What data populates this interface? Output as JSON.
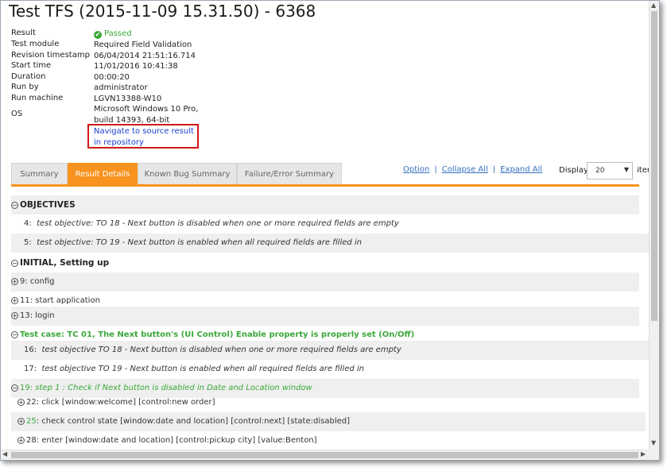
{
  "title": "Test TFS (2015-11-09 15.31.50) - 6368",
  "info": {
    "result_label": "Result",
    "result_value": "Passed",
    "module_label": "Test module",
    "module_value": "Required Field Validation",
    "revision_label": "Revision timestamp",
    "revision_value": "06/04/2014 21:51:16.714",
    "start_label": "Start time",
    "start_value": "11/01/2016 10:41:38",
    "duration_label": "Duration",
    "duration_value": "00:00:20",
    "runby_label": "Run by",
    "runby_value": "administrator",
    "machine_label": "Run machine",
    "machine_value": "LGVN13388-W10",
    "os_label": "OS",
    "os_value_1": "Microsoft Windows 10 Pro,",
    "os_value_2": "build 14393, 64-bit",
    "nav_link": "Navigate to source result in repository"
  },
  "tabs": [
    "Summary",
    "Result Details",
    "Known Bug Summary",
    "Failure/Error Summary"
  ],
  "active_tab": "Result Details",
  "links": {
    "option": "Option",
    "collapse": "Collapse All",
    "expand": "Expand All"
  },
  "display": {
    "label": "Display",
    "value": "20",
    "suffix": "iter"
  },
  "tree": {
    "objectives": "OBJECTIVES",
    "obj_4_num": "4:",
    "obj_4": "test objective: TO 18 - Next button is disabled when one or more required fields are empty",
    "obj_5_num": "5:",
    "obj_5": "test objective: TO 19 - Next button is enabled when all required fields are filled in",
    "initial": "INITIAL, Setting up",
    "r9": "9: config",
    "r11": "11: start application",
    "r13": "13: login",
    "tc": "Test case: TC 01, The Next button's (UI Control) Enable property is properly set (On/Off)",
    "r16_num": "16:",
    "r16": "test objective TO 18 - Next button is disabled when one or more required fields are empty",
    "r17_num": "17:",
    "r17": "test objective TO 19 - Next button is enabled when all required fields are filled in",
    "r19_num": "19:",
    "r19": "step 1 : Check if Next button is disabled in Date and Location window",
    "r22": "22: click  [window:welcome] [control:new order]",
    "r25_num": "25",
    "r25": ": check control state  [window:date and location] [control:next] [state:disabled]",
    "r28": "28: enter  [window:date and location] [control:pickup city] [value:Benton]"
  },
  "colors": {
    "accent": "#f7931e",
    "passed": "#3aa83a",
    "link": "#1a3fd0",
    "highlight_border": "#d01818"
  }
}
